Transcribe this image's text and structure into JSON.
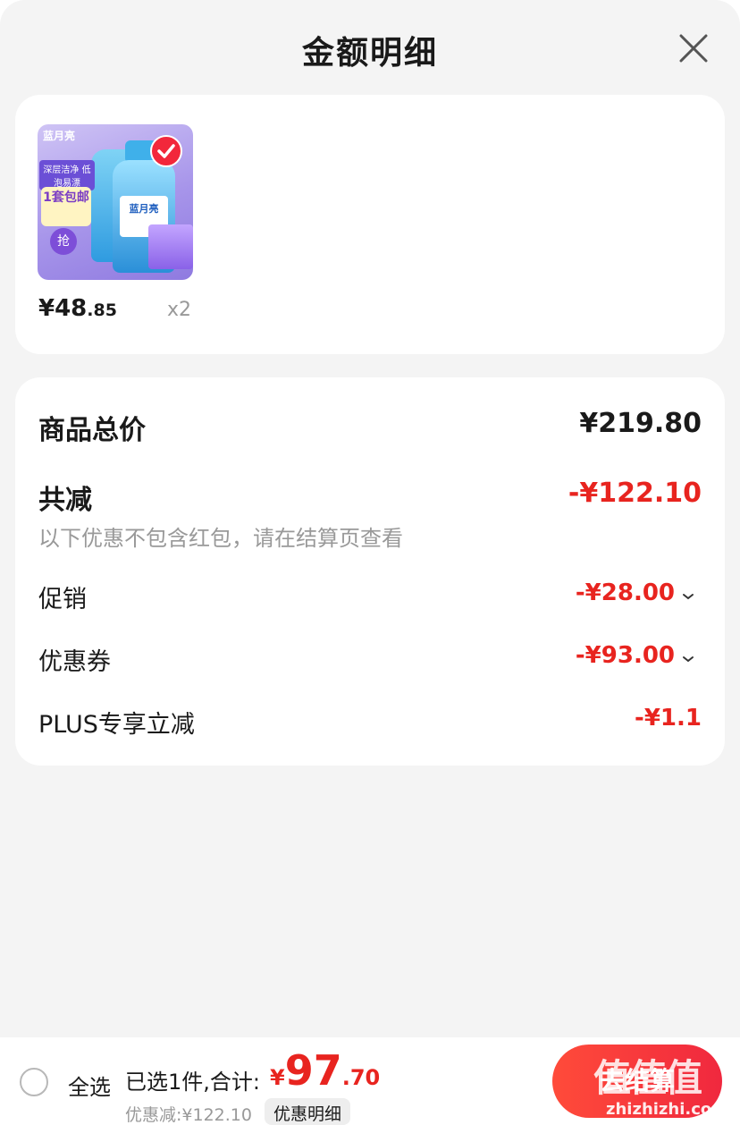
{
  "header": {
    "title": "金额明细"
  },
  "product": {
    "thumb_brand": "蓝月亮",
    "thumb_tag1": "深层洁净 低泡易漂",
    "thumb_tag2": "1套包邮",
    "thumb_button": "抢",
    "price_int": "¥48",
    "price_dec": ".85",
    "quantity": "x2"
  },
  "summary": {
    "total_label": "商品总价",
    "total_value": "¥219.80",
    "reduce_label": "共减",
    "reduce_value": "-¥122.10",
    "note": "以下优惠不包含红包，请在结算页查看",
    "items": [
      {
        "label": "促销",
        "value": "-¥28.00",
        "expandable": true
      },
      {
        "label": "优惠券",
        "value": "-¥93.00",
        "expandable": true
      },
      {
        "label": "PLUS专享立减",
        "value": "-¥1.1",
        "expandable": false
      }
    ]
  },
  "footer": {
    "select_all": "全选",
    "selected_text": "已选1件,合计:",
    "total_currency": "¥",
    "total_int": "97",
    "total_dec": ".70",
    "discount_text": "优惠减:¥122.10",
    "detail_button": "优惠明细",
    "checkout_button": "去结算"
  },
  "watermark": {
    "chars": "值值值",
    "url": "zhizhizhi.com"
  },
  "colors": {
    "accent_red": "#e8241f",
    "background": "#f4f4f4",
    "card": "#ffffff"
  }
}
